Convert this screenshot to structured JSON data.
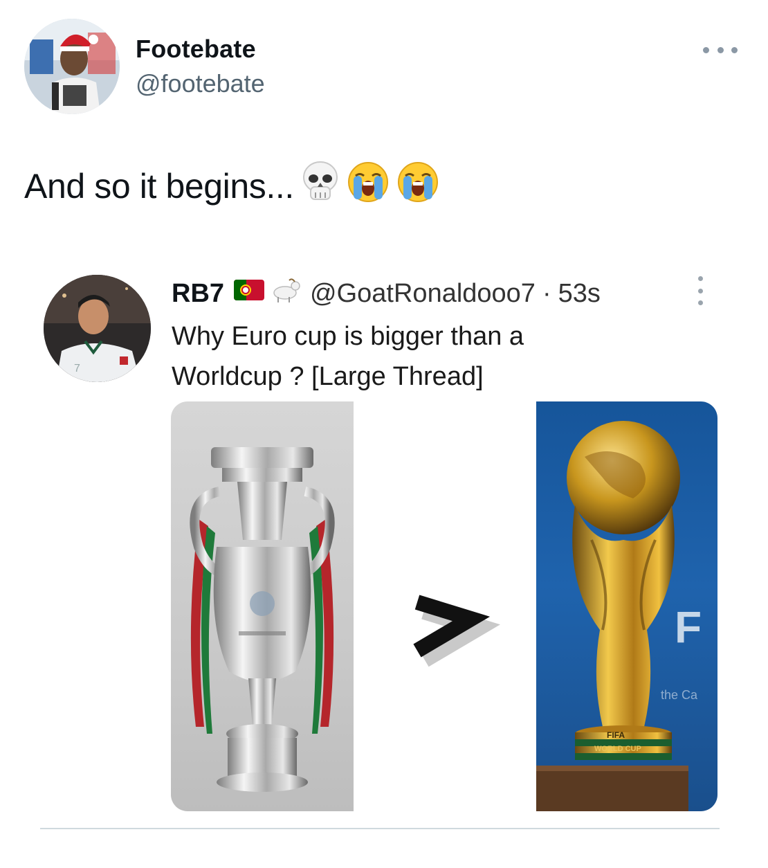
{
  "tweet": {
    "author_name": "Footebate",
    "author_handle": "@footebate",
    "text": "And so it begins...",
    "emojis": [
      "skull-emoji",
      "loudly-crying-emoji",
      "loudly-crying-emoji"
    ]
  },
  "quoted_tweet": {
    "author_name": "RB7",
    "badges": [
      "portugal-flag-emoji",
      "goat-emoji"
    ],
    "handle": "@GoatRonaldooo7",
    "separator": "·",
    "time": "53s",
    "text_line1": "Why Euro cup is bigger than a",
    "text_line2": "Worldcup ? [Large Thread]",
    "media": {
      "left_image": "euro-cup-trophy",
      "middle_symbol": ">",
      "right_image": "world-cup-trophy",
      "right_watermark_letter": "F",
      "right_watermark_text": "the Ca",
      "trophy_base_text_1": "FIFA",
      "trophy_base_text_2": "WORLD CUP"
    }
  },
  "colors": {
    "text": "#0f1419",
    "secondary_text": "#536471",
    "fifa_blue": "#1f63ad",
    "gold": "#c8961e"
  }
}
